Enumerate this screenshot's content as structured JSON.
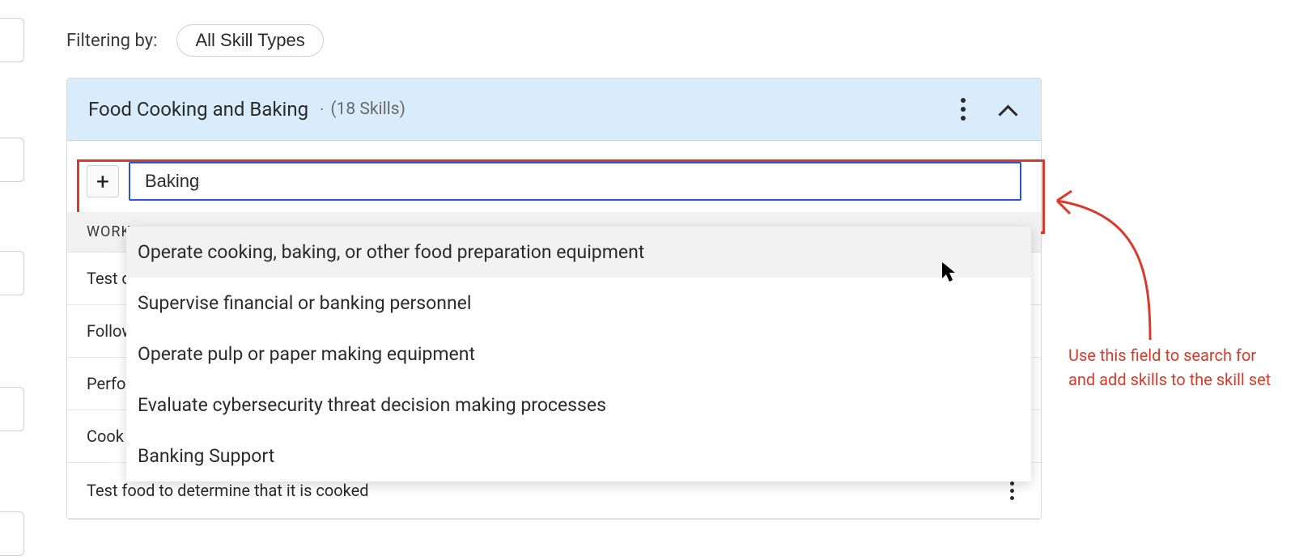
{
  "filter": {
    "label": "Filtering by:",
    "pill": "All Skill Types"
  },
  "group": {
    "title": "Food Cooking and Baking",
    "dot": "·",
    "count": "(18 Skills)"
  },
  "search": {
    "value": "Baking",
    "plus": "+"
  },
  "dropdown": [
    "Operate cooking, baking, or other food preparation equipment",
    "Supervise financial or banking personnel",
    "Operate pulp or paper making equipment",
    "Evaluate cybersecurity threat decision making processes",
    "Banking Support"
  ],
  "table": {
    "header_partial": "WORK",
    "rows_truncated": [
      "Test c",
      "Follow",
      "Perfor",
      "Cook f"
    ],
    "row_full": "Test food to determine that it is cooked"
  },
  "annotation": {
    "line1": "Use this field to search for",
    "line2": "and add skills to the skill set"
  },
  "colors": {
    "callout": "#d83a2b",
    "input_focus": "#2a53d6",
    "header_bg": "#d9ecfb"
  }
}
